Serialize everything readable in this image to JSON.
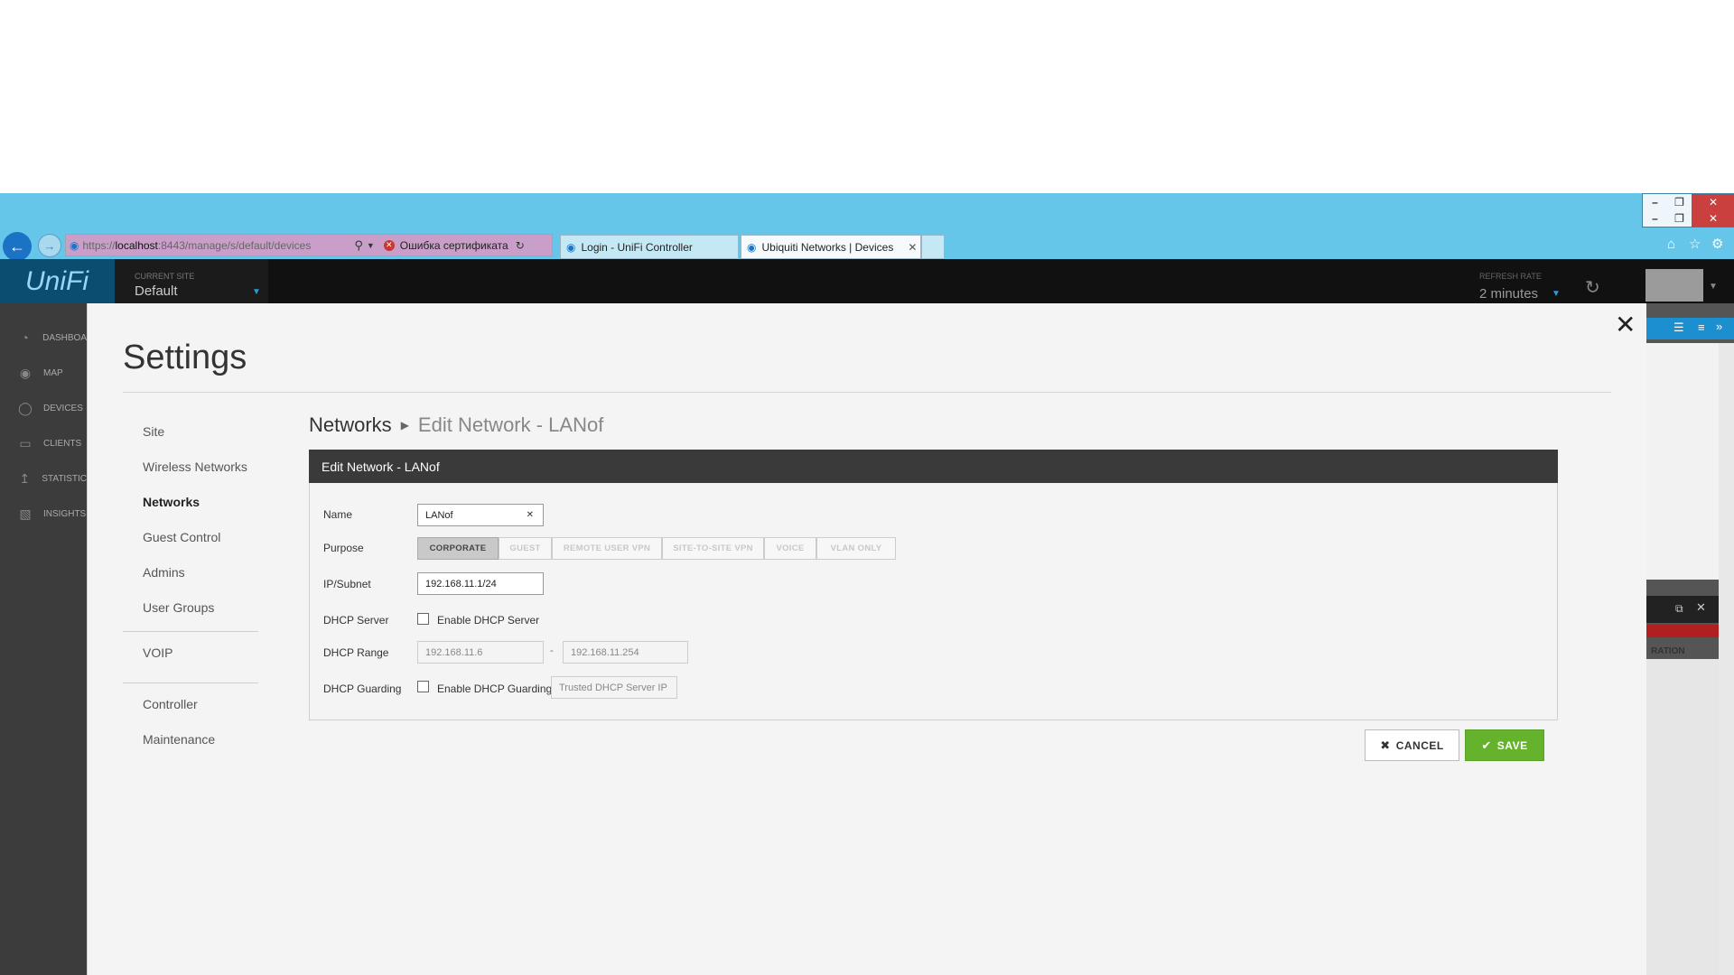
{
  "browser": {
    "url_prefix": "https://",
    "url_host": "localhost",
    "url_rest": ":8443/manage/s/default/devices",
    "cert_error": "Ошибка сертификата",
    "tabs": [
      {
        "label": "Login - UniFi Controller"
      },
      {
        "label": "Ubiquiti Networks | Devices"
      }
    ],
    "window_controls": [
      "–",
      "❐",
      "✕",
      "–",
      "❐",
      "✕"
    ]
  },
  "header": {
    "logo": "UniFi",
    "site_caption": "CURRENT SITE",
    "site_value": "Default",
    "refresh_caption": "REFRESH RATE",
    "refresh_value": "2 minutes"
  },
  "left_nav": [
    {
      "label": "DASHBOA",
      "icon": "dashboard-icon"
    },
    {
      "label": "MAP",
      "icon": "map-pin-icon"
    },
    {
      "label": "DEVICES",
      "icon": "devices-icon"
    },
    {
      "label": "CLIENTS",
      "icon": "clients-icon"
    },
    {
      "label": "STATISTIC",
      "icon": "statistics-icon"
    },
    {
      "label": "INSIGHTS",
      "icon": "insights-icon"
    }
  ],
  "right_bg": {
    "column_label": "RATION"
  },
  "settings": {
    "title": "Settings",
    "close": "✕",
    "sidebar": [
      "Site",
      "Wireless Networks",
      "Networks",
      "Guest Control",
      "Admins",
      "User Groups",
      "VOIP",
      "Controller",
      "Maintenance"
    ]
  },
  "breadcrumb": {
    "root": "Networks",
    "current": "Edit Network - LANof"
  },
  "form": {
    "panel_title": "Edit Network - LANof",
    "name_label": "Name",
    "name_value": "LANof",
    "purpose_label": "Purpose",
    "purpose_options": [
      "CORPORATE",
      "GUEST",
      "REMOTE USER VPN",
      "SITE-TO-SITE VPN",
      "VOICE",
      "VLAN ONLY"
    ],
    "ip_label": "IP/Subnet",
    "ip_value": "192.168.11.1/24",
    "dhcp_server_label": "DHCP Server",
    "dhcp_server_checkbox": "Enable DHCP Server",
    "dhcp_range_label": "DHCP Range",
    "dhcp_range_start": "192.168.11.6",
    "dhcp_range_sep": "-",
    "dhcp_range_end": "192.168.11.254",
    "dhcp_guard_label": "DHCP Guarding",
    "dhcp_guard_checkbox": "Enable DHCP Guarding",
    "dhcp_guard_placeholder": "Trusted DHCP Server IP"
  },
  "actions": {
    "cancel": "CANCEL",
    "save": "SAVE"
  }
}
